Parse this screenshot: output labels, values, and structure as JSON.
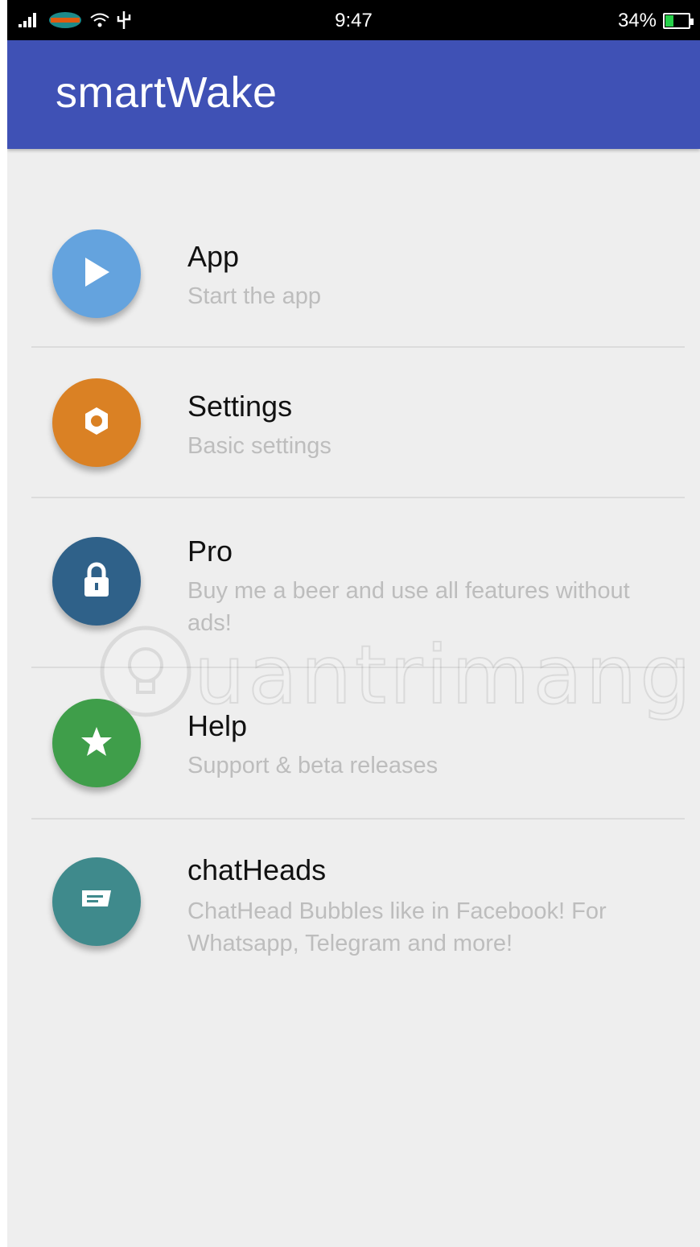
{
  "status_bar": {
    "time": "9:47",
    "battery_percent": "34%",
    "battery_level": 0.34,
    "icons": [
      "signal-icon",
      "carrier-icon",
      "wifi-icon",
      "usb-icon",
      "battery-icon"
    ]
  },
  "app_bar": {
    "title": "smartWake",
    "color": "#3f51b5"
  },
  "menu": {
    "items": [
      {
        "title": "App",
        "subtitle": "Start the app",
        "icon": "play-icon",
        "color": "#64a3de"
      },
      {
        "title": "Settings",
        "subtitle": "Basic settings",
        "icon": "gear-icon",
        "color": "#da8124"
      },
      {
        "title": "Pro",
        "subtitle": "Buy me a beer and use all features without ads!",
        "icon": "lock-icon",
        "color": "#2f6189"
      },
      {
        "title": "Help",
        "subtitle": "Support & beta releases",
        "icon": "star-icon",
        "color": "#3f9e4a"
      },
      {
        "title": "chatHeads",
        "subtitle": "ChatHead Bubbles like in Facebook! For Whatsapp, Telegram and more!",
        "icon": "chat-bubble-icon",
        "color": "#3f8a8c"
      }
    ]
  },
  "watermark": {
    "text": "uantrimang"
  }
}
